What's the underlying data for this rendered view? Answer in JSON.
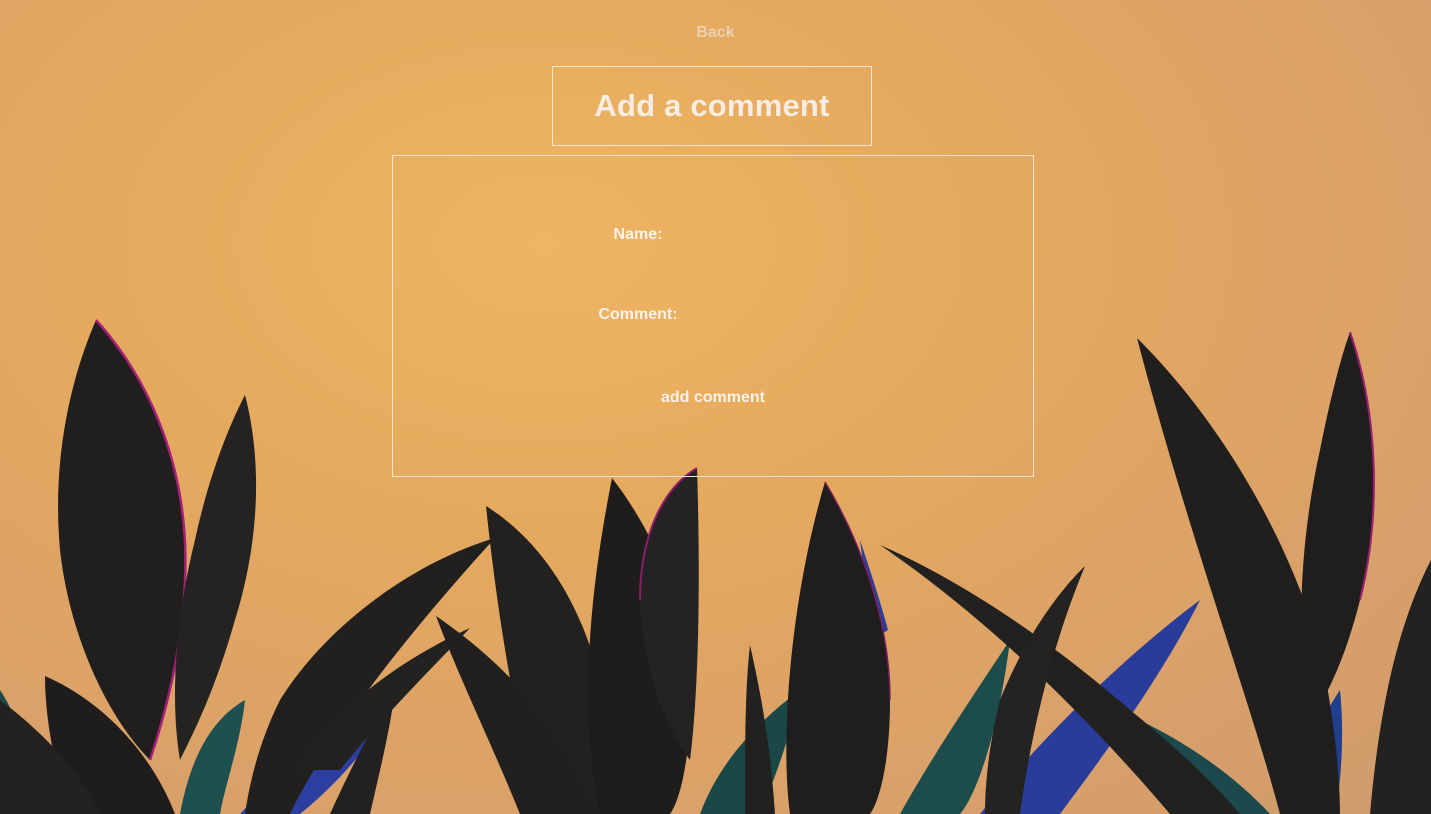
{
  "nav": {
    "back_label": "Back"
  },
  "header": {
    "title": "Add a comment"
  },
  "form": {
    "name_label": "Name:",
    "name_value": "",
    "comment_label": "Comment:",
    "comment_value": "",
    "submit_label": "add comment"
  },
  "colors": {
    "wall": "#e5a95e",
    "leaf_dark": "#1f1e1d",
    "leaf_teal": "#1d4a4a",
    "leaf_blue": "#2b3f9c",
    "leaf_edge": "#9a1f6e",
    "border": "#f3e5d2"
  }
}
